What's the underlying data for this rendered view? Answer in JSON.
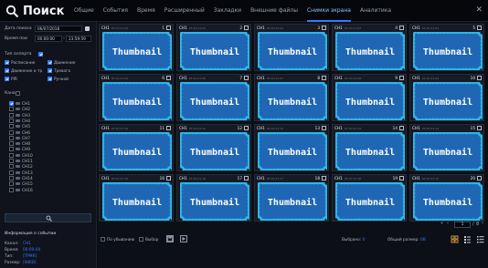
{
  "header": {
    "title": "Поиск",
    "tabs": [
      "Общие",
      "События",
      "Время",
      "Расширенный",
      "Закладки",
      "Внешние файлы",
      "Снимки экрана",
      "Аналитика"
    ],
    "active_tab": "Снимки экрана"
  },
  "left": {
    "search_date_label": "Дата поиска",
    "search_date_value": "06/07/2018",
    "search_time_label": "Время пои",
    "time_start": "00:00:00",
    "time_end": "23:59:59",
    "alarm_type_label": "Тип аллерта",
    "types": [
      {
        "label": "Расписание",
        "checked": true
      },
      {
        "label": "Движение",
        "checked": true
      },
      {
        "label": "Движение и тр",
        "checked": true
      },
      {
        "label": "Тревога",
        "checked": true
      },
      {
        "label": "PIR",
        "checked": true
      },
      {
        "label": "Ручной",
        "checked": true
      }
    ],
    "channel_label": "Канал",
    "channels": [
      {
        "label": "CH1",
        "checked": true
      },
      {
        "label": "CH2",
        "checked": false
      },
      {
        "label": "CH3",
        "checked": false
      },
      {
        "label": "CH4",
        "checked": false
      },
      {
        "label": "CH5",
        "checked": false
      },
      {
        "label": "CH6",
        "checked": false
      },
      {
        "label": "CH7",
        "checked": false
      },
      {
        "label": "CH8",
        "checked": false
      },
      {
        "label": "CH9",
        "checked": false
      },
      {
        "label": "CH10",
        "checked": false
      },
      {
        "label": "CH11",
        "checked": false
      },
      {
        "label": "CH12",
        "checked": false
      },
      {
        "label": "CH13",
        "checked": false
      },
      {
        "label": "CH14",
        "checked": false
      },
      {
        "label": "CH15",
        "checked": false
      },
      {
        "label": "CH16",
        "checked": false
      }
    ],
    "info_title": "Информация о событии",
    "info": [
      {
        "k": "Канал:",
        "v": "CH1"
      },
      {
        "k": "Время:",
        "v": "00:00:00"
      },
      {
        "k": "Тип:",
        "v": "[TPMR]"
      },
      {
        "k": "Размер:",
        "v": "[98KB]"
      }
    ]
  },
  "grid": {
    "thumbnail_text": "Thumbnail",
    "cells": [
      {
        "ch": "CH1",
        "ts": "05:10:21:00",
        "num": "1"
      },
      {
        "ch": "CH1",
        "ts": "05:10:21:01",
        "num": "2"
      },
      {
        "ch": "CH1",
        "ts": "05:10:21:02",
        "num": "3"
      },
      {
        "ch": "CH1",
        "ts": "05:10:21:03",
        "num": "4"
      },
      {
        "ch": "CH1",
        "ts": "05:10:21:04",
        "num": "5"
      },
      {
        "ch": "CH1",
        "ts": "05:10:21:05",
        "num": "6"
      },
      {
        "ch": "CH1",
        "ts": "05:10:21:06",
        "num": "7"
      },
      {
        "ch": "CH1",
        "ts": "05:10:21:07",
        "num": "8"
      },
      {
        "ch": "CH1",
        "ts": "05:10:21:08",
        "num": "9"
      },
      {
        "ch": "CH1",
        "ts": "05:10:21:09",
        "num": "10"
      },
      {
        "ch": "CH1",
        "ts": "05:10:21:10",
        "num": "11"
      },
      {
        "ch": "CH1",
        "ts": "05:10:21:11",
        "num": "12"
      },
      {
        "ch": "CH1",
        "ts": "05:10:21:12",
        "num": "13"
      },
      {
        "ch": "CH1",
        "ts": "05:10:21:13",
        "num": "14"
      },
      {
        "ch": "CH1",
        "ts": "05:10:21:14",
        "num": "15"
      },
      {
        "ch": "CH1",
        "ts": "05:10:21:15",
        "num": "16"
      },
      {
        "ch": "CH1",
        "ts": "05:10:21:16",
        "num": "17"
      },
      {
        "ch": "CH1",
        "ts": "05:10:21:17",
        "num": "18"
      },
      {
        "ch": "CH1",
        "ts": "05:10:21:18",
        "num": "19"
      },
      {
        "ch": "CH1",
        "ts": "05:10:21:19",
        "num": "20"
      }
    ]
  },
  "bottom": {
    "sort_label": "По убыванию",
    "select_label": "Выбор",
    "page_current": "1",
    "page_total": "8",
    "selected_label": "Выбрано:",
    "selected_value": "0",
    "total_size_label": "Общий размер:",
    "total_size_value": "0B"
  },
  "colors": {
    "accent": "#2d7cff",
    "thumb_border": "#2fb7e8",
    "thumb_fill": "#1f67b4"
  }
}
